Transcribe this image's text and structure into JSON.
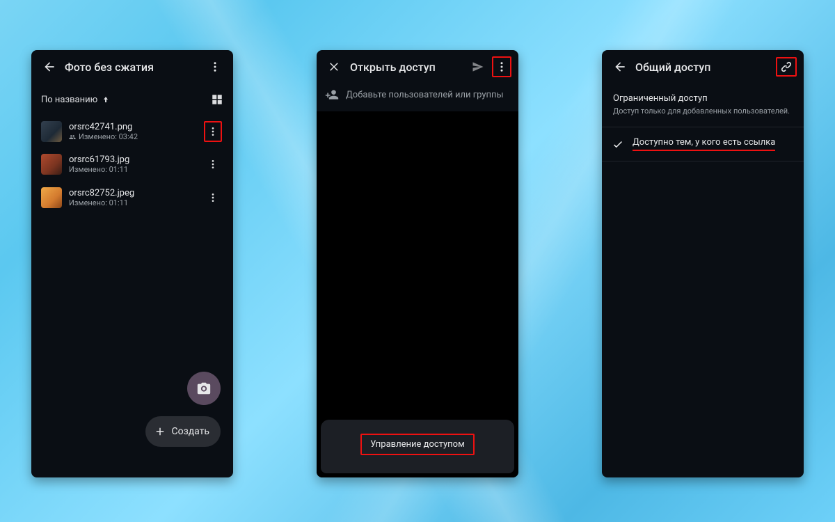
{
  "phone1": {
    "title": "Фото без сжатия",
    "sort_label": "По названию",
    "files": [
      {
        "name": "orsrc42741.png",
        "meta": "Изменено: 03:42",
        "shared": true,
        "thumb_colors": [
          "#33404f",
          "#1e2a36",
          "#6e5a3f"
        ]
      },
      {
        "name": "orsrc61793.jpg",
        "meta": "Изменено: 01:11",
        "shared": false,
        "thumb_colors": [
          "#b04a2e",
          "#7a3420",
          "#3a1d16"
        ]
      },
      {
        "name": "orsrc82752.jpeg",
        "meta": "Изменено: 01:11",
        "shared": false,
        "thumb_colors": [
          "#f0a948",
          "#d37a2e",
          "#8c4718"
        ]
      }
    ],
    "create_label": "Создать"
  },
  "phone2": {
    "title": "Открыть доступ",
    "add_placeholder": "Добавьте пользователей или группы",
    "manage_label": "Управление доступом"
  },
  "phone3": {
    "title": "Общий доступ",
    "restricted_title": "Ограниченный доступ",
    "restricted_sub": "Доступ только для добавленных пользователей.",
    "anyone_label": "Доступно тем, у кого есть ссылка"
  }
}
